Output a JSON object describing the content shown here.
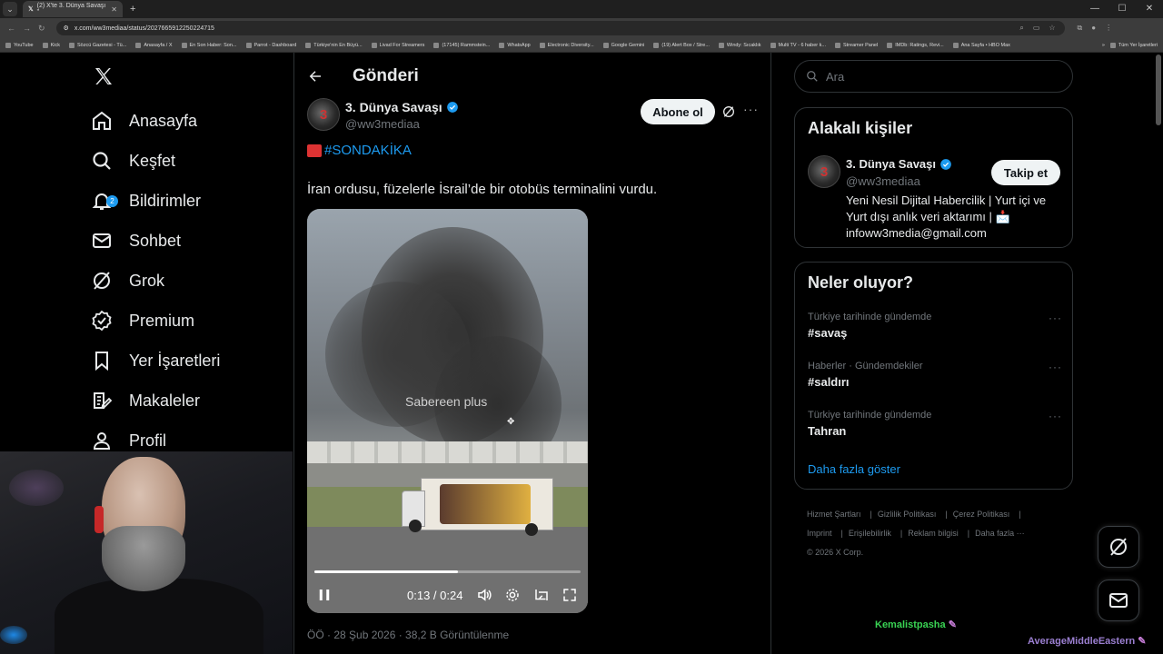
{
  "browser": {
    "tab_title": "(2) X'te 3. Dünya Savaşı \"",
    "url": "x.com/ww3mediaa/status/2027665912250224715",
    "bookmarks": [
      "YouTube",
      "Kick",
      "Sözcü Gazetesi - Tü...",
      "Anasayfa / X",
      "En Son Haber: Son...",
      "Parrot - Dashboard",
      "Türkiye'nin En Büyü...",
      "Livad For Streamers",
      "(17145) Rammstein...",
      "WhatsApp",
      "Electronic Diversity...",
      "Google Gemini",
      "(19) Alert Box / Stre...",
      "Windy: Sıcaklık",
      "Multi TV - 6 haber k...",
      "Streamer Panel",
      "IMDb: Ratings, Revi...",
      "Ana Sayfa • HBO Max"
    ],
    "bookmarks_more": "»",
    "all_bookmarks": "Tüm Yer İşaretleri"
  },
  "nav": {
    "items": [
      {
        "label": "Anasayfa",
        "icon": "home-icon"
      },
      {
        "label": "Keşfet",
        "icon": "search-icon"
      },
      {
        "label": "Bildirimler",
        "icon": "bell-icon",
        "badge": "2"
      },
      {
        "label": "Sohbet",
        "icon": "mail-icon"
      },
      {
        "label": "Grok",
        "icon": "grok-icon"
      },
      {
        "label": "Premium",
        "icon": "premium-icon"
      },
      {
        "label": "Yer İşaretleri",
        "icon": "bookmark-icon"
      },
      {
        "label": "Makaleler",
        "icon": "article-icon"
      },
      {
        "label": "Profil",
        "icon": "profile-icon"
      }
    ]
  },
  "post": {
    "header_title": "Gönderi",
    "author_name": "3. Dünya Savaşı",
    "author_handle": "@ww3mediaa",
    "subscribe_label": "Abone ol",
    "hashtag": "#SONDAKİKA",
    "text": "İran ordusu, füzelerle İsrail’de bir otobüs terminalini vurdu.",
    "video": {
      "watermark": "Sabereen plus",
      "time": "0:13 / 0:24",
      "progress": 0.54
    },
    "meta_partial": "ÖÖ · 28 Şub 2026 · 38,2 B Görüntülenme"
  },
  "search": {
    "placeholder": "Ara"
  },
  "related": {
    "title": "Alakalı kişiler",
    "name": "3. Dünya Savaşı",
    "handle": "@ww3mediaa",
    "follow_label": "Takip et",
    "bio": "Yeni Nesil Dijital Habercilik | Yurt içi ve Yurt dışı anlık veri aktarımı | 📩 infoww3media@gmail.com"
  },
  "trends": {
    "title": "Neler oluyor?",
    "items": [
      {
        "context": "Türkiye tarihinde gündemde",
        "name": "#savaş"
      },
      {
        "context": "Haberler · Gündemdekiler",
        "name": "#saldırı"
      },
      {
        "context": "Türkiye tarihinde gündemde",
        "name": "Tahran"
      }
    ],
    "show_more": "Daha fazla göster"
  },
  "footer": {
    "links": [
      "Hizmet Şartları",
      "Gizlilik Politikası",
      "Çerez Politikası",
      "Imprint",
      "Erişilebilirlik",
      "Reklam bilgisi",
      "Daha fazla ···"
    ],
    "copyright": "© 2026 X Corp."
  },
  "overlay": {
    "name1": "Kemalistpasha",
    "name2": "AverageMiddleEastern"
  },
  "colors": {
    "accent": "#1d9bf0",
    "background": "#000000",
    "overlay_name1": "#39d353",
    "overlay_name2": "#9b7fd1"
  }
}
